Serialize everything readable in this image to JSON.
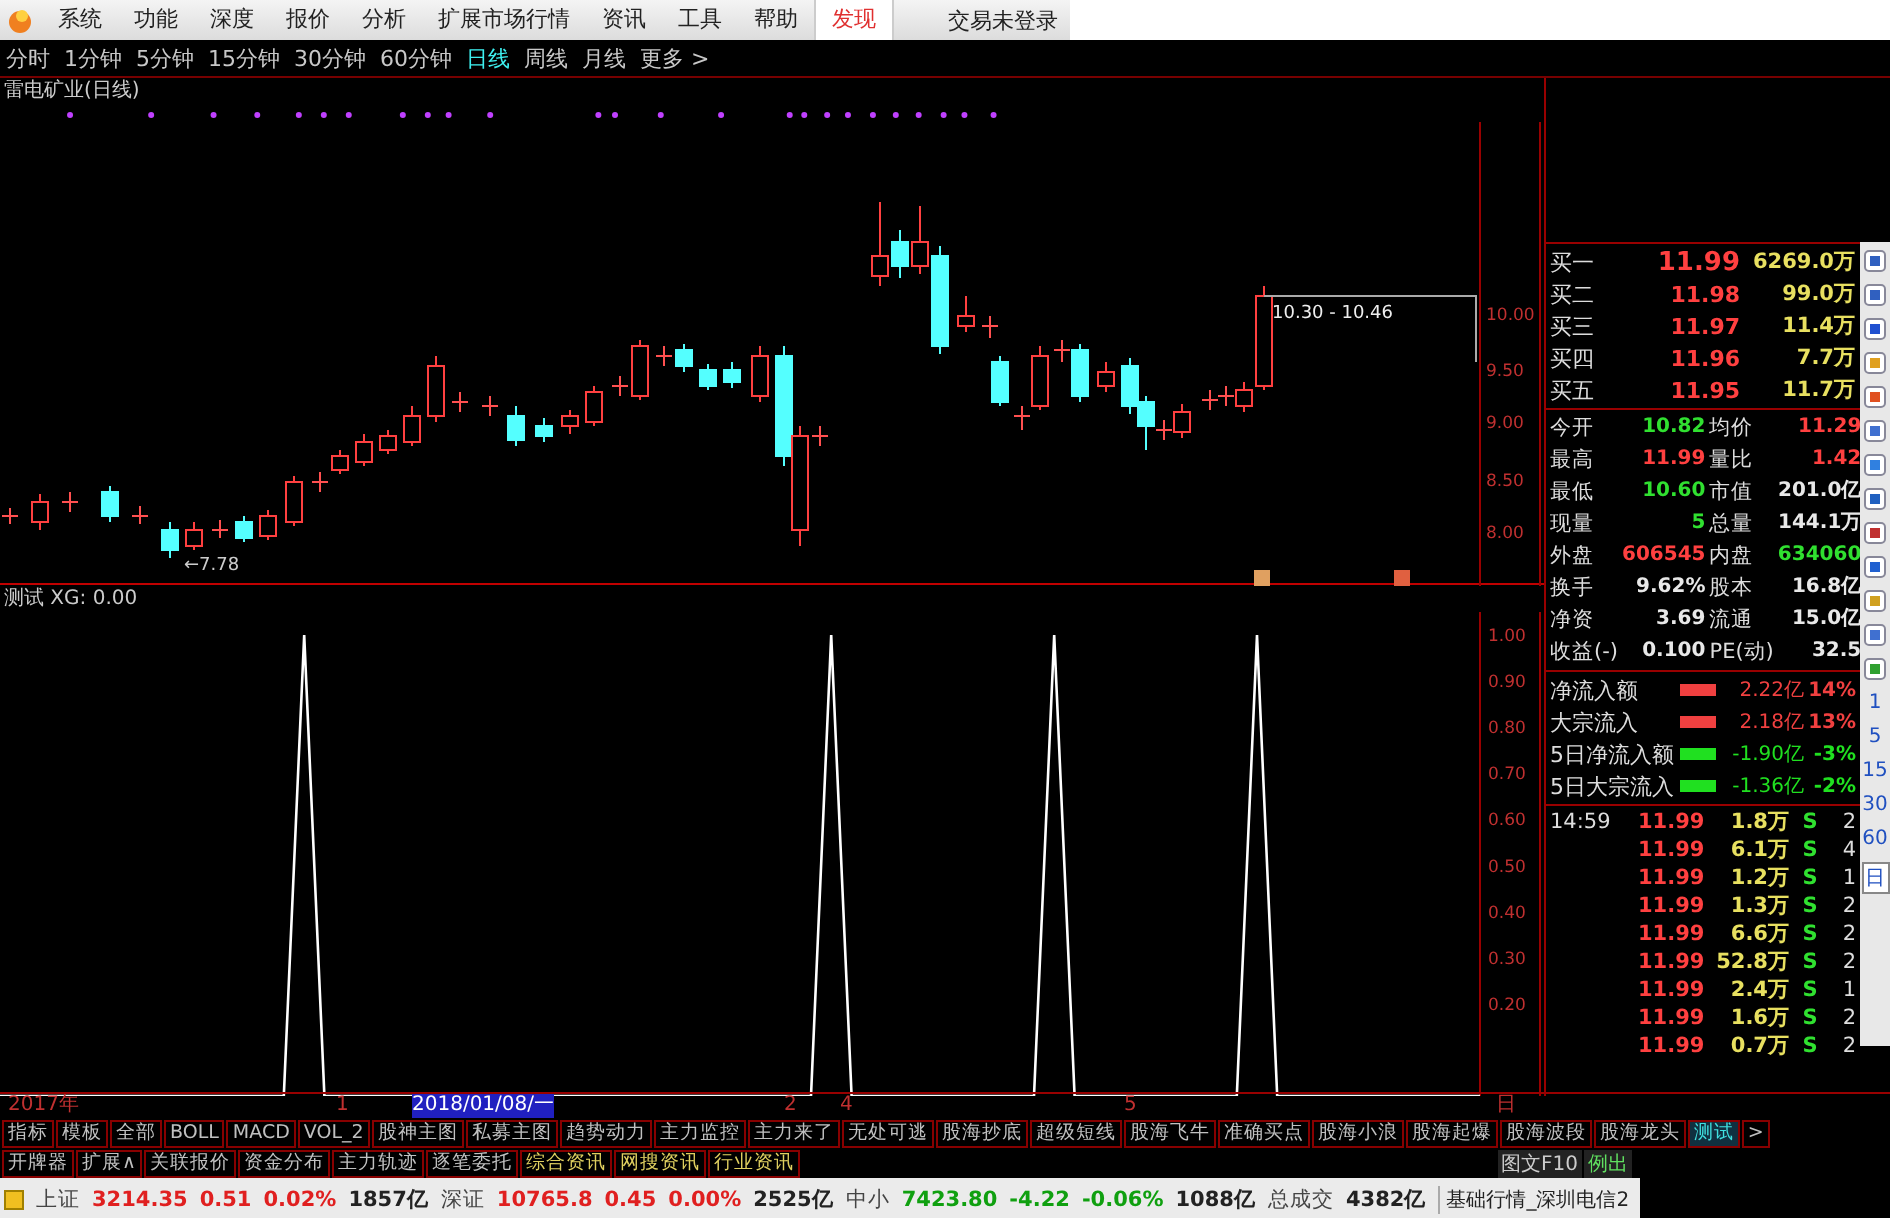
{
  "menu": {
    "items": [
      {
        "label": "系统",
        "selected": false
      },
      {
        "label": "功能",
        "selected": false
      },
      {
        "label": "深度",
        "selected": false
      },
      {
        "label": "报价",
        "selected": false
      },
      {
        "label": "分析",
        "selected": false
      },
      {
        "label": "扩展市场行情",
        "selected": false
      },
      {
        "label": "资讯",
        "selected": false
      },
      {
        "label": "工具",
        "selected": false
      },
      {
        "label": "帮助",
        "selected": false
      },
      {
        "label": "发现",
        "selected": true
      }
    ],
    "login_status": "交易未登录"
  },
  "periods": [
    {
      "label": "分时",
      "selected": false
    },
    {
      "label": "1分钟",
      "selected": false
    },
    {
      "label": "5分钟",
      "selected": false
    },
    {
      "label": "15分钟",
      "selected": false
    },
    {
      "label": "30分钟",
      "selected": false
    },
    {
      "label": "60分钟",
      "selected": false
    },
    {
      "label": "日线",
      "selected": true
    },
    {
      "label": "周线",
      "selected": false
    },
    {
      "label": "月线",
      "selected": false
    },
    {
      "label": "更多 >",
      "selected": false
    }
  ],
  "chart": {
    "title": "雷电矿业(日线)",
    "low_label": "←7.78",
    "range_label": "10.30 - 10.46",
    "price_ticks": [
      "10.00",
      "9.50",
      "9.00",
      "8.50",
      "8.00"
    ]
  },
  "indicator": {
    "label": "测试 XG: 0.00",
    "chart_data": {
      "type": "line",
      "series": [
        {
          "color": "#ffffff",
          "values": [
            0,
            0,
            0,
            0,
            0,
            0,
            0,
            0,
            0,
            0,
            0,
            0,
            0,
            0,
            0,
            1,
            0,
            0,
            0,
            0,
            0,
            0,
            0,
            0,
            0,
            0,
            0,
            0,
            0,
            0,
            0,
            0,
            0,
            0,
            0,
            0,
            0,
            0,
            0,
            0,
            0,
            1,
            0,
            0,
            0,
            0,
            0,
            0,
            0,
            0,
            0,
            0,
            1,
            0,
            0,
            0,
            0,
            0,
            0,
            0,
            0,
            0,
            1,
            0,
            0,
            0,
            0,
            0,
            0,
            0,
            0,
            0,
            0,
            0
          ]
        }
      ],
      "ylim": [
        0,
        1.05
      ],
      "yticks": [
        {
          "value": 1,
          "label": "1.00"
        },
        {
          "value": 0.9,
          "label": "0.90"
        },
        {
          "value": 0.8,
          "label": "0.80"
        },
        {
          "value": 0.7,
          "label": "0.70"
        },
        {
          "value": 0.6,
          "label": "0.60"
        },
        {
          "value": 0.5,
          "label": "0.50"
        },
        {
          "value": 0.4,
          "label": "0.40"
        },
        {
          "value": 0.3,
          "label": "0.30"
        },
        {
          "value": 0.2,
          "label": "0.20"
        }
      ]
    }
  },
  "date_axis": [
    {
      "label": "2017年",
      "selected": false
    },
    {
      "label": "1",
      "selected": false
    },
    {
      "label": "2018/01/08/一",
      "selected": true
    },
    {
      "label": "2",
      "selected": false
    },
    {
      "label": "4",
      "selected": false
    },
    {
      "label": "5",
      "selected": false
    },
    {
      "label": "日",
      "selected": false
    }
  ],
  "quote": {
    "bids": [
      {
        "label": "买一",
        "price": "11.99",
        "volume": "6269.0万"
      },
      {
        "label": "买二",
        "price": "11.98",
        "volume": "99.0万"
      },
      {
        "label": "买三",
        "price": "11.97",
        "volume": "11.4万"
      },
      {
        "label": "买四",
        "price": "11.96",
        "volume": "7.7万"
      },
      {
        "label": "买五",
        "price": "11.95",
        "volume": "11.7万"
      }
    ],
    "stats": [
      {
        "label": "今开",
        "value": "10.82",
        "color": "#30e030"
      },
      {
        "label": "均价",
        "value": "11.29",
        "color": "#ff4040"
      },
      {
        "label": "最高",
        "value": "11.99",
        "color": "#ff4040"
      },
      {
        "label": "量比",
        "value": "1.42",
        "color": "#ff4040"
      },
      {
        "label": "最低",
        "value": "10.60",
        "color": "#30e030"
      },
      {
        "label": "市值",
        "value": "201.0亿",
        "color": "#e8e8e8"
      },
      {
        "label": "现量",
        "value": "5",
        "color": "#30e030"
      },
      {
        "label": "总量",
        "value": "144.1万",
        "color": "#e8e8e8"
      },
      {
        "label": "外盘",
        "value": "606545",
        "color": "#ff4040"
      },
      {
        "label": "内盘",
        "value": "634060",
        "color": "#30e030"
      },
      {
        "label": "换手",
        "value": "9.62%",
        "color": "#e8e8e8"
      },
      {
        "label": "股本",
        "value": "16.8亿",
        "color": "#e8e8e8"
      },
      {
        "label": "净资",
        "value": "3.69",
        "color": "#e8e8e8"
      },
      {
        "label": "流通",
        "value": "15.0亿",
        "color": "#e8e8e8"
      },
      {
        "label": "收益(-)",
        "value": "0.100",
        "color": "#e8e8e8"
      },
      {
        "label": "PE(动)",
        "value": "32.5",
        "color": "#e8e8e8"
      }
    ],
    "flows": [
      {
        "label": "净流入额",
        "color": "#f04040",
        "amount": "2.22亿",
        "percent": "14%"
      },
      {
        "label": "大宗流入",
        "color": "#f04040",
        "amount": "2.18亿",
        "percent": "13%"
      },
      {
        "label": "5日净流入额",
        "color": "#20e020",
        "amount": "-1.90亿",
        "percent": "-3%"
      },
      {
        "label": "5日大宗流入",
        "color": "#20e020",
        "amount": "-1.36亿",
        "percent": "-2%"
      }
    ],
    "ticks": [
      {
        "time": "14:59",
        "price": "11.99",
        "volume": "1.8万",
        "side": "S",
        "count": "2"
      },
      {
        "price": "11.99",
        "volume": "6.1万",
        "side": "S",
        "count": "4"
      },
      {
        "price": "11.99",
        "volume": "1.2万",
        "side": "S",
        "count": "1"
      },
      {
        "price": "11.99",
        "volume": "1.3万",
        "side": "S",
        "count": "2"
      },
      {
        "price": "11.99",
        "volume": "6.6万",
        "side": "S",
        "count": "2"
      },
      {
        "price": "11.99",
        "volume": "52.8万",
        "side": "S",
        "count": "2"
      },
      {
        "price": "11.99",
        "volume": "2.4万",
        "side": "S",
        "count": "1"
      },
      {
        "price": "11.99",
        "volume": "1.6万",
        "side": "S",
        "count": "2"
      },
      {
        "price": "11.99",
        "volume": "0.7万",
        "side": "S",
        "count": "2"
      }
    ]
  },
  "toolbar_periods": [
    "1",
    "5",
    "15",
    "30",
    "60",
    "日"
  ],
  "indicator_tabs": [
    {
      "label": "指标",
      "selected": false
    },
    {
      "label": "模板",
      "selected": false
    },
    {
      "label": "全部",
      "selected": false
    },
    {
      "label": "BOLL",
      "selected": false
    },
    {
      "label": "MACD",
      "selected": false
    },
    {
      "label": "VOL_2",
      "selected": false
    },
    {
      "label": "股神主图",
      "selected": false
    },
    {
      "label": "私募主图",
      "selected": false
    },
    {
      "label": "趋势动力",
      "selected": false
    },
    {
      "label": "主力监控",
      "selected": false
    },
    {
      "label": "主力来了",
      "selected": false
    },
    {
      "label": "无处可逃",
      "selected": false
    },
    {
      "label": "股海抄底",
      "selected": false
    },
    {
      "label": "超级短线",
      "selected": false
    },
    {
      "label": "股海飞牛",
      "selected": false
    },
    {
      "label": "准确买点",
      "selected": false
    },
    {
      "label": "股海小浪",
      "selected": false
    },
    {
      "label": "股海起爆",
      "selected": false
    },
    {
      "label": "股海波段",
      "selected": false
    },
    {
      "label": "股海龙头",
      "selected": false
    },
    {
      "label": "测试",
      "selected": true
    },
    {
      "label": ">",
      "selected": false
    }
  ],
  "info_tabs": [
    {
      "label": "开牌器",
      "kind": "tool"
    },
    {
      "label": "扩展∧",
      "kind": "tool"
    },
    {
      "label": "关联报价",
      "kind": "tool"
    },
    {
      "label": "资金分布",
      "kind": "tool"
    },
    {
      "label": "主力轨迹",
      "kind": "tool"
    },
    {
      "label": "逐笔委托",
      "kind": "tool"
    },
    {
      "label": "综合资讯",
      "kind": "news"
    },
    {
      "label": "网搜资讯",
      "kind": "news"
    },
    {
      "label": "行业资讯",
      "kind": "news"
    }
  ],
  "f10": [
    "图文F10",
    "例出"
  ],
  "status_bar": {
    "indices": [
      {
        "name": "上证",
        "value": "3214.35",
        "change": "0.51",
        "percent": "0.02%",
        "turnover": "1857亿",
        "color": "#e02020"
      },
      {
        "name": "深证",
        "value": "10765.8",
        "change": "0.45",
        "percent": "0.00%",
        "turnover": "2525亿",
        "color": "#e02020"
      },
      {
        "name": "中小",
        "value": "7423.80",
        "change": "-4.22",
        "percent": "-0.06%",
        "turnover": "1088亿",
        "color": "#10a010"
      }
    ],
    "total_label": "总成交",
    "total": "4382亿",
    "server": "基础行情_深圳电信2"
  }
}
